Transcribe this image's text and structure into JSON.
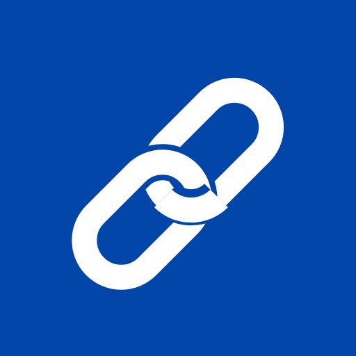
{
  "icon": {
    "name": "link-icon",
    "background_color": "#0145A8",
    "foreground_color": "#FFFFFF"
  }
}
